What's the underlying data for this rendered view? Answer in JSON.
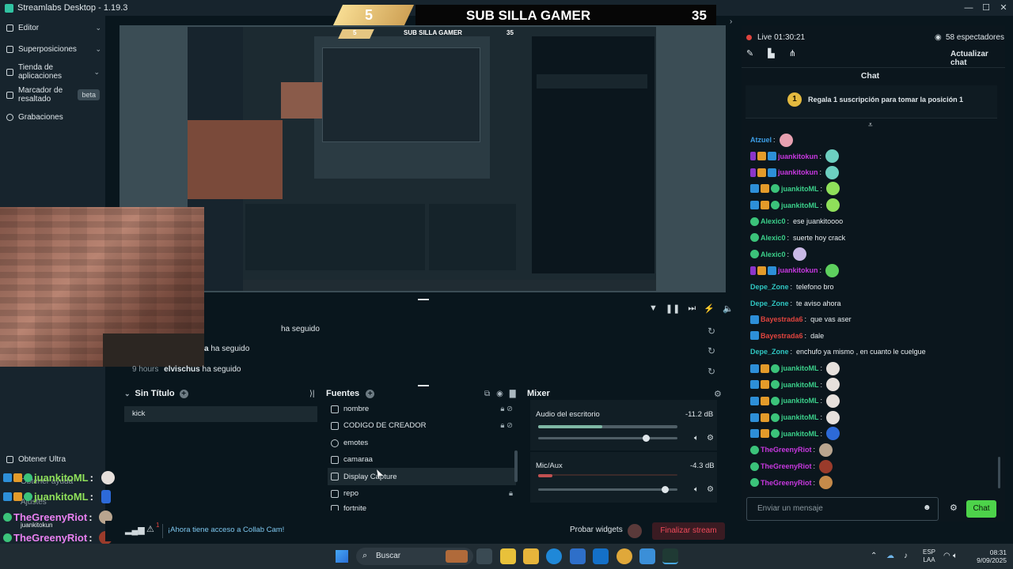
{
  "window": {
    "title": "Streamlabs Desktop - 1.19.3"
  },
  "sidebar": {
    "items": [
      {
        "label": "Editor"
      },
      {
        "label": "Superposiciones"
      },
      {
        "label": "Tienda de aplicaciones"
      },
      {
        "label": "Marcador de resaltado",
        "badge": "beta"
      },
      {
        "label": "Grabaciones"
      }
    ],
    "bottom_items": [
      {
        "label": "Obtener Ultra"
      },
      {
        "label": "Obtener ayuda"
      },
      {
        "label": "Ajustes"
      }
    ]
  },
  "stream_banner": {
    "left_number": "5",
    "title": "SUB SILLA GAMER",
    "right_number": "35"
  },
  "nested_banner": {
    "left_number": "5",
    "title": "SUB SILLA GAMER",
    "right_number": "35"
  },
  "overlay_chat": [
    {
      "user": "juankitoML",
      "sep": ":"
    },
    {
      "user": "juankitoML",
      "sep": ":"
    },
    {
      "user": "TheGreenyRiot",
      "sep": ":"
    },
    {
      "user": "juankitokun",
      "sep": ""
    },
    {
      "user": "TheGreenyRiot",
      "sep": ":"
    },
    {
      "user": "TheGreenyRiot",
      "sep": ":"
    }
  ],
  "events": [
    {
      "time": "",
      "user": "",
      "action": "ha seguido"
    },
    {
      "time": "",
      "user": "a",
      "action": "ha seguido"
    },
    {
      "time": "9 hours",
      "user": "elvischus",
      "action": "ha seguido"
    }
  ],
  "scenes": {
    "title": "Sin Título",
    "items": [
      "kick"
    ]
  },
  "sources": {
    "title": "Fuentes",
    "items": [
      "nombre",
      "CODIGO DE CREADOR",
      "emotes",
      "camaraa",
      "Display Capture",
      "repo",
      "fortnite"
    ]
  },
  "mixer": {
    "title": "Mixer",
    "channels": [
      {
        "name": "Audio del escritorio",
        "db": "-11.2 dB",
        "level": 0.46,
        "volume": 0.77
      },
      {
        "name": "Mic/Aux",
        "db": "-4.3 dB",
        "level": 0.1,
        "volume": 0.91
      }
    ]
  },
  "status": {
    "collab_text": "¡Ahora tiene acceso a Collab Cam!",
    "probar_widgets": "Probar widgets",
    "finalize_button": "Finalizar stream",
    "badge_count": "1"
  },
  "live": {
    "status": "Live 01:30:21",
    "viewers": "58 espectadores",
    "refresh_chat": "Actualizar chat"
  },
  "chat": {
    "title": "Chat",
    "gift_number": "1",
    "gift_text": "Regala 1 suscripción para tomar la posición 1",
    "input_placeholder": "Enviar un mensaje",
    "send_label": "Chat",
    "messages": [
      {
        "user": "Atzuel",
        "text": "",
        "color": "name-blue",
        "badges": [],
        "emote": "#e7a0b0"
      },
      {
        "user": "juankitokun",
        "text": "",
        "color": "name-mag",
        "badges": [
          "b-mic",
          "b-vip",
          "b-mod"
        ],
        "emote": "#6dcfc0"
      },
      {
        "user": "juankitokun",
        "text": "",
        "color": "name-mag",
        "badges": [
          "b-mic",
          "b-vip",
          "b-mod"
        ],
        "emote": "#6dcfc0"
      },
      {
        "user": "juankitoML",
        "text": "",
        "color": "name-green",
        "badges": [
          "b-mod",
          "b-vip",
          "b-sub"
        ],
        "emote": "#8fe05a"
      },
      {
        "user": "juankitoML",
        "text": "",
        "color": "name-green",
        "badges": [
          "b-mod",
          "b-vip",
          "b-sub"
        ],
        "emote": "#8fe05a"
      },
      {
        "user": "Alexic0",
        "text": "ese juankitoooo",
        "color": "name-green",
        "badges": [
          "b-glob"
        ],
        "emote": ""
      },
      {
        "user": "Alexic0",
        "text": "suerte hoy crack",
        "color": "name-green",
        "badges": [
          "b-glob"
        ],
        "emote": ""
      },
      {
        "user": "Alexic0",
        "text": "",
        "color": "name-green",
        "badges": [
          "b-glob"
        ],
        "emote": "#c9b9e6"
      },
      {
        "user": "juankitokun",
        "text": "",
        "color": "name-mag",
        "badges": [
          "b-mic",
          "b-vip",
          "b-mod"
        ],
        "emote": "#5ed05e"
      },
      {
        "user": "Depe_Zone",
        "text": "telefono bro",
        "color": "name-teal",
        "badges": [],
        "emote": ""
      },
      {
        "user": "Depe_Zone",
        "text": "te aviso ahora",
        "color": "name-teal",
        "badges": [],
        "emote": ""
      },
      {
        "user": "Bayestrada6",
        "text": "que vas aser",
        "color": "name-red",
        "badges": [
          "b-mod"
        ],
        "emote": ""
      },
      {
        "user": "Bayestrada6",
        "text": "dale",
        "color": "name-red",
        "badges": [
          "b-mod"
        ],
        "emote": ""
      },
      {
        "user": "Depe_Zone",
        "text": "enchufo ya mismo , en cuanto le cuelgue",
        "color": "name-teal",
        "badges": [],
        "emote": ""
      },
      {
        "user": "juankitoML",
        "text": "",
        "color": "name-green",
        "badges": [
          "b-mod",
          "b-vip",
          "b-sub"
        ],
        "emote": "#e6e0dc"
      },
      {
        "user": "juankitoML",
        "text": "",
        "color": "name-green",
        "badges": [
          "b-mod",
          "b-vip",
          "b-sub"
        ],
        "emote": "#e6e0dc"
      },
      {
        "user": "juankitoML",
        "text": "",
        "color": "name-green",
        "badges": [
          "b-mod",
          "b-vip",
          "b-sub"
        ],
        "emote": "#e6e0dc"
      },
      {
        "user": "juankitoML",
        "text": "",
        "color": "name-green",
        "badges": [
          "b-mod",
          "b-vip",
          "b-sub"
        ],
        "emote": "#e6e0dc"
      },
      {
        "user": "juankitoML",
        "text": "",
        "color": "name-green",
        "badges": [
          "b-mod",
          "b-vip",
          "b-sub"
        ],
        "emote": "#2d6ad8"
      },
      {
        "user": "TheGreenyRiot",
        "text": "",
        "color": "name-mag",
        "badges": [
          "b-glob"
        ],
        "emote": "#b9a58f"
      },
      {
        "user": "TheGreenyRiot",
        "text": "",
        "color": "name-mag",
        "badges": [
          "b-glob"
        ],
        "emote": "#9a3b2b"
      },
      {
        "user": "TheGreenyRiot",
        "text": "",
        "color": "name-mag",
        "badges": [
          "b-glob"
        ],
        "emote": "#c58a4a"
      }
    ]
  },
  "taskbar": {
    "search": "Buscar",
    "lang": "ESP",
    "lang2": "LAA",
    "time": "08:31",
    "date": "9/09/2025"
  }
}
